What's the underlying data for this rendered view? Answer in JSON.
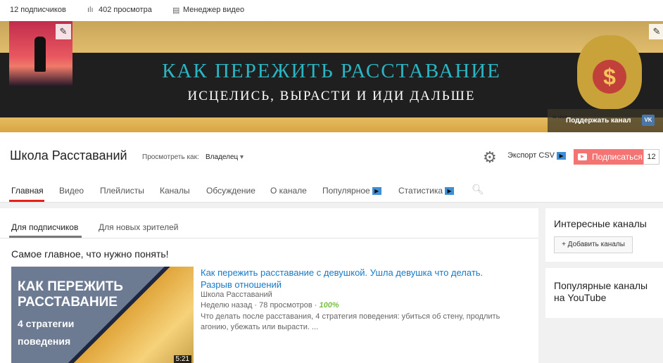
{
  "topbar": {
    "subscribers": "12 подписчиков",
    "views": "402 просмотра",
    "video_manager": "Менеджер видео"
  },
  "banner": {
    "title": "КАК ПЕРЕЖИТЬ РАССТАВАНИЕ",
    "subtitle": "ИСЦЕЛИСЬ, ВЫРАСТИ И ИДИ ДАЛЬШЕ",
    "support_label": "Поддержать канал",
    "support_logo": "to click",
    "vk_label": "VK",
    "bag_symbol": "$"
  },
  "channel": {
    "name": "Школа Расставаний",
    "view_as_label": "Просмотреть как:",
    "view_as_value": "Владелец",
    "export_csv": "Экспорт CSV",
    "subscribe": "Подписаться",
    "subscribe_count": "12"
  },
  "tabs": [
    "Главная",
    "Видео",
    "Плейлисты",
    "Каналы",
    "Обсуждение",
    "О канале",
    "Популярное",
    "Статистика"
  ],
  "subtabs": [
    "Для подписчиков",
    "Для новых зрителей"
  ],
  "section": {
    "title": "Самое главное, что нужно понять!",
    "video": {
      "thumb_line1": "КАК ПЕРЕЖИТЬ",
      "thumb_line2": "РАССТАВАНИЕ",
      "thumb_line3": "4 стратегии",
      "thumb_line4": "поведения",
      "duration": "5:21",
      "title": "Как пережить расставание с девушкой. Ушла девушка что делать. Разрыв отношений",
      "channel": "Школа Расставаний",
      "age": "Неделю назад",
      "views": "78 просмотров",
      "rating": "100%",
      "description": "Что делать после расставания, 4 стратегия поведения: убиться об стену, продлить агонию, убежать или вырасти. ..."
    }
  },
  "sidebar": {
    "interesting_title": "Интересные каналы",
    "add_channels": "+ Добавить каналы",
    "popular_title": "Популярные каналы на YouTube"
  },
  "colors": {
    "accent_red": "#e62117",
    "subscribe": "#f47373",
    "link": "#167ac6",
    "rating": "#7ac143"
  }
}
